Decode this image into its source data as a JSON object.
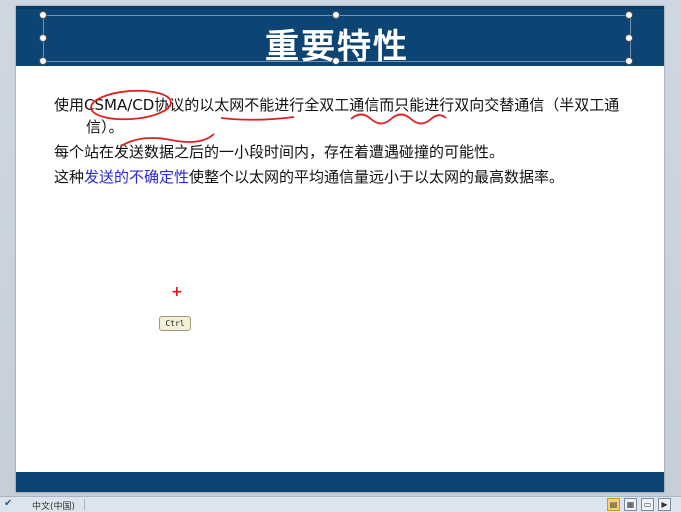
{
  "slide": {
    "title": "重要特性",
    "paragraphs": [
      {
        "segments": [
          {
            "text": "使用",
            "style": "normal"
          },
          {
            "text": "CSMA/CD",
            "style": "normal"
          },
          {
            "text": "协议的以太网不能进行全双工通信而只能进行双向交替通信（半双工通信）。",
            "style": "normal"
          }
        ]
      },
      {
        "segments": [
          {
            "text": "每个站在发送数据之后的一小段时间内，存在着遭遇碰撞的可能性。",
            "style": "normal"
          }
        ]
      },
      {
        "segments": [
          {
            "text": "这种",
            "style": "normal"
          },
          {
            "text": "发送的不确定性",
            "style": "blue"
          },
          {
            "text": "使整个以太网的平均通信量远小于以太网的最高数据率。",
            "style": "normal"
          }
        ]
      }
    ],
    "annotation_color": "#e02020",
    "title_bar_color": "#0c4473",
    "emphasis_color": "#2a2ad0"
  },
  "overlay": {
    "cursor_symbol": "+",
    "key_badge": "Ctrl"
  },
  "statusbar": {
    "language": "中文(中国)",
    "view_icons": [
      "normal-view-icon",
      "slide-sorter-icon",
      "reading-view-icon",
      "slideshow-icon"
    ]
  }
}
